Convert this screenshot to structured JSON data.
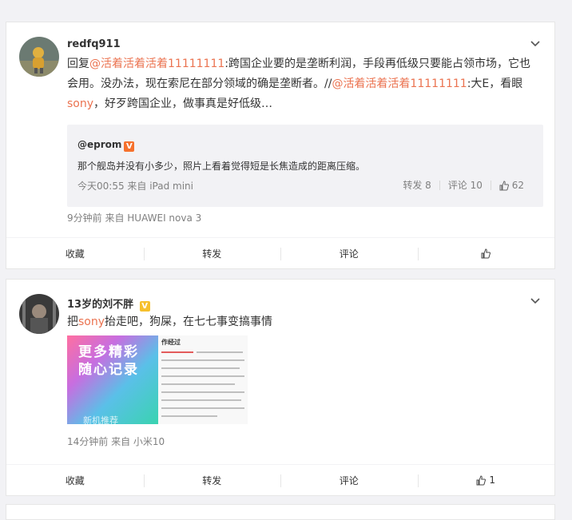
{
  "posts": [
    {
      "username": "redfq911",
      "text_parts": {
        "p1": "回复",
        "mention1": "@活着活着活着11111111",
        "p2": ":跨国企业要的是垄断利润，手段再低级只要能占领市场，它也会用。没办法，现在索尼在部分领域的确是垄断者。//",
        "mention2": "@活着活着活着11111111",
        "p3": ":大E，看眼",
        "brand": "sony",
        "p4": "，好歹跨国企业，做事真是好低级…"
      },
      "quote": {
        "user": "@eprom",
        "vip_badge": "V",
        "text": "那个舰岛并没有小多少，照片上看着觉得短是长焦造成的距离压缩。",
        "meta": "今天00:55 来自 iPad mini",
        "repost": "转发 8",
        "comment": "评论 10",
        "likes": "62"
      },
      "meta": "9分钟前  来自 HUAWEI nova 3",
      "actions": {
        "collect": "收藏",
        "repost": "转发",
        "comment": "评论",
        "like": ""
      }
    },
    {
      "username": "13岁的刘不胖",
      "verified_badge": "V",
      "text_parts": {
        "p1": "把",
        "brand": "sony",
        "p2": "抬走吧，狗屎，在七七事变搞事情"
      },
      "image": {
        "left_text_line1": "更多精彩",
        "left_text_line2": "随心记录",
        "left_bottom": "新机推荐",
        "right_title": "作经过"
      },
      "meta": "14分钟前  来自 小米10",
      "actions": {
        "collect": "收藏",
        "repost": "转发",
        "comment": "评论",
        "like": "1"
      }
    }
  ],
  "colors": {
    "link": "#eb7350",
    "muted": "#808080",
    "bg": "#f2f2f5"
  }
}
